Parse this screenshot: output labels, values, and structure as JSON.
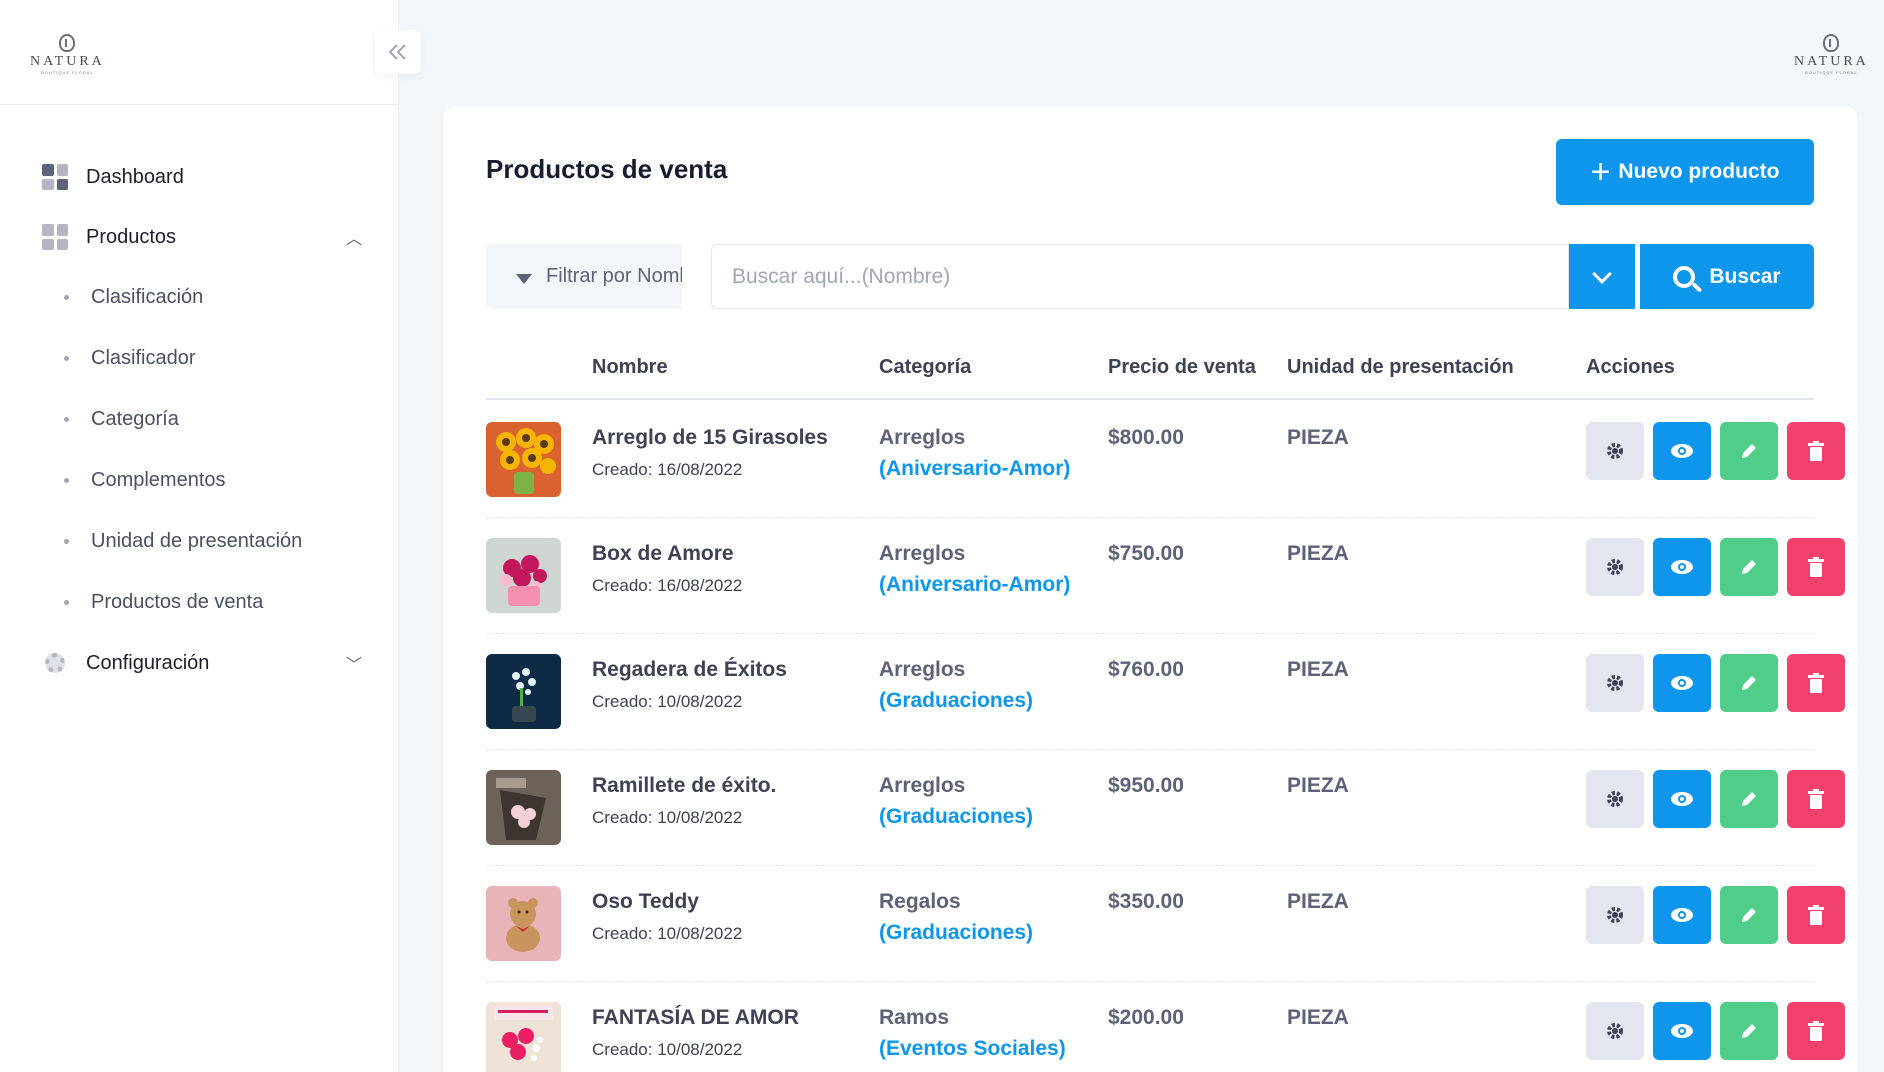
{
  "brand": {
    "name": "NATURA",
    "tagline": "BOUTIQUE FLORAL"
  },
  "sidebar": {
    "items": [
      {
        "label": "Dashboard"
      },
      {
        "label": "Productos",
        "expanded": true,
        "children": [
          {
            "label": "Clasificación"
          },
          {
            "label": "Clasificador"
          },
          {
            "label": "Categoría"
          },
          {
            "label": "Complementos"
          },
          {
            "label": "Unidad de presentación"
          },
          {
            "label": "Productos de venta"
          }
        ]
      },
      {
        "label": "Configuración",
        "expanded": false
      }
    ]
  },
  "page": {
    "title": "Productos de venta",
    "new_button": "Nuevo producto",
    "filter_label": "Filtrar por Nombre",
    "search_placeholder": "Buscar aquí...(Nombre)",
    "search_button": "Buscar"
  },
  "table": {
    "columns": [
      "Nombre",
      "Categoría",
      "Precio de venta",
      "Unidad de presentación",
      "Acciones"
    ],
    "rows": [
      {
        "name": "Arreglo de 15 Girasoles",
        "created": "Creado: 16/08/2022",
        "category": "Arreglos",
        "subcategory": "(Aniversario-Amor)",
        "price": "$800.00",
        "unit": "PIEZA"
      },
      {
        "name": "Box de Amore",
        "created": "Creado: 16/08/2022",
        "category": "Arreglos",
        "subcategory": "(Aniversario-Amor)",
        "price": "$750.00",
        "unit": "PIEZA"
      },
      {
        "name": "Regadera de Éxitos",
        "created": "Creado: 10/08/2022",
        "category": "Arreglos",
        "subcategory": "(Graduaciones)",
        "price": "$760.00",
        "unit": "PIEZA"
      },
      {
        "name": "Ramillete de éxito.",
        "created": "Creado: 10/08/2022",
        "category": "Arreglos",
        "subcategory": "(Graduaciones)",
        "price": "$950.00",
        "unit": "PIEZA"
      },
      {
        "name": "Oso Teddy",
        "created": "Creado: 10/08/2022",
        "category": "Regalos",
        "subcategory": "(Graduaciones)",
        "price": "$350.00",
        "unit": "PIEZA"
      },
      {
        "name": "FANTASÍA DE AMOR",
        "created": "Creado: 10/08/2022",
        "category": "Ramos",
        "subcategory": "(Eventos Sociales)",
        "price": "$200.00",
        "unit": "PIEZA"
      }
    ]
  },
  "icons": {
    "sidebar_toggle": "double-chevron-left-icon",
    "row_actions": [
      "gear-icon",
      "eye-icon",
      "pencil-icon",
      "trash-icon"
    ]
  },
  "colors": {
    "primary": "#0d96ec",
    "success": "#50cd89",
    "danger": "#f1416c",
    "light": "#e4e6ef",
    "background": "#f3f6f9"
  }
}
